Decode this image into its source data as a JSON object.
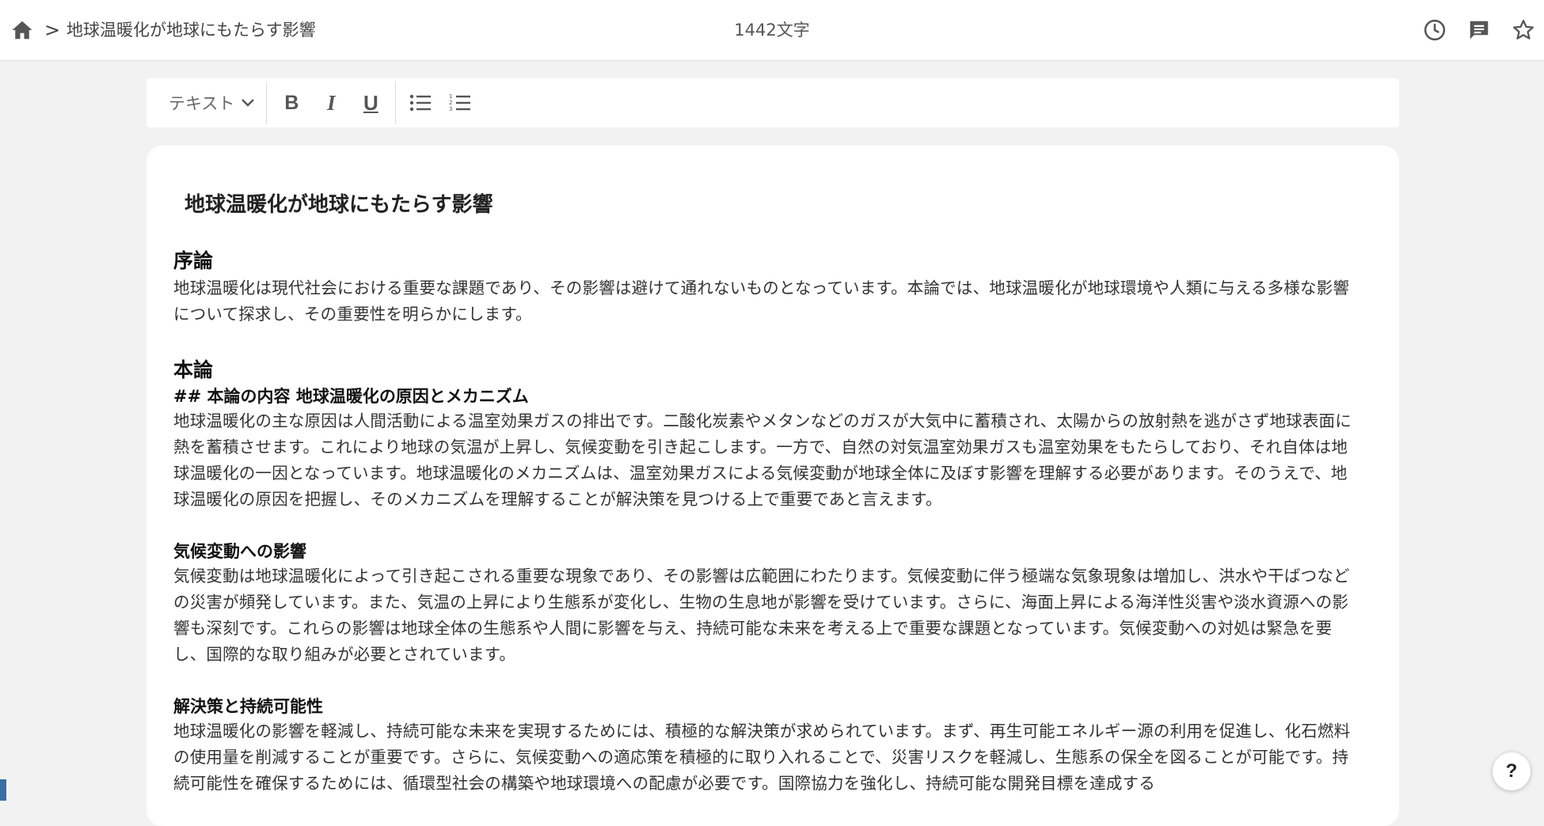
{
  "header": {
    "home_icon": "home-icon",
    "breadcrumb_separator": ">",
    "document_title": "地球温暖化が地球にもたらす影響",
    "char_count": "1442文字",
    "icons": [
      "history-icon",
      "comment-icon",
      "star-icon"
    ]
  },
  "toolbar": {
    "style_select": "テキスト",
    "bold": "B",
    "italic": "I",
    "underline": "U",
    "icons": [
      "chevron-down-icon",
      "bullet-list-icon",
      "numbered-list-icon"
    ]
  },
  "document": {
    "title": "地球温暖化が地球にもたらす影響",
    "sections": [
      {
        "heading": "序論",
        "paragraphs": [
          "地球温暖化は現代社会における重要な課題であり、その影響は避けて通れないものとなっています。本論では、地球温暖化が地球環境や人類に与える多様な影響について探求し、その重要性を明らかにします。"
        ]
      },
      {
        "heading": "本論",
        "subheading": "## 本論の内容 地球温暖化の原因とメカニズム",
        "paragraphs": [
          "地球温暖化の主な原因は人間活動による温室効果ガスの排出です。二酸化炭素やメタンなどのガスが大気中に蓄積され、太陽からの放射熱を逃がさず地球表面に熱を蓄積させます。これにより地球の気温が上昇し、気候変動を引き起こします。一方で、自然の対気温室効果ガスも温室効果をもたらしており、それ自体は地球温暖化の一因となっています。地球温暖化のメカニズムは、温室効果ガスによる気候変動が地球全体に及ぼす影響を理解する必要があります。そのうえで、地球温暖化の原因を把握し、そのメカニズムを理解することが解決策を見つける上で重要であと言えます。"
        ]
      },
      {
        "subheading": "気候変動への影響",
        "paragraphs": [
          "気候変動は地球温暖化によって引き起こされる重要な現象であり、その影響は広範囲にわたります。気候変動に伴う極端な気象現象は増加し、洪水や干ばつなどの災害が頻発しています。また、気温の上昇により生態系が変化し、生物の生息地が影響を受けています。さらに、海面上昇による海洋性災害や淡水資源への影響も深刻です。これらの影響は地球全体の生態系や人間に影響を与え、持続可能な未来を考える上で重要な課題となっています。気候変動への対処は緊急を要し、国際的な取り組みが必要とされています。"
        ]
      },
      {
        "subheading": "解決策と持続可能性",
        "paragraphs": [
          "地球温暖化の影響を軽減し、持続可能な未来を実現するためには、積極的な解決策が求められています。まず、再生可能エネルギー源の利用を促進し、化石燃料の使用量を削減することが重要です。さらに、気候変動への適応策を積極的に取り入れることで、災害リスクを軽減し、生態系の保全を図ることが可能です。持続可能性を確保するためには、循環型社会の構築や地球環境への配慮が必要です。国際協力を強化し、持続可能な開発目標を達成する"
        ]
      }
    ]
  },
  "help_button": "?"
}
